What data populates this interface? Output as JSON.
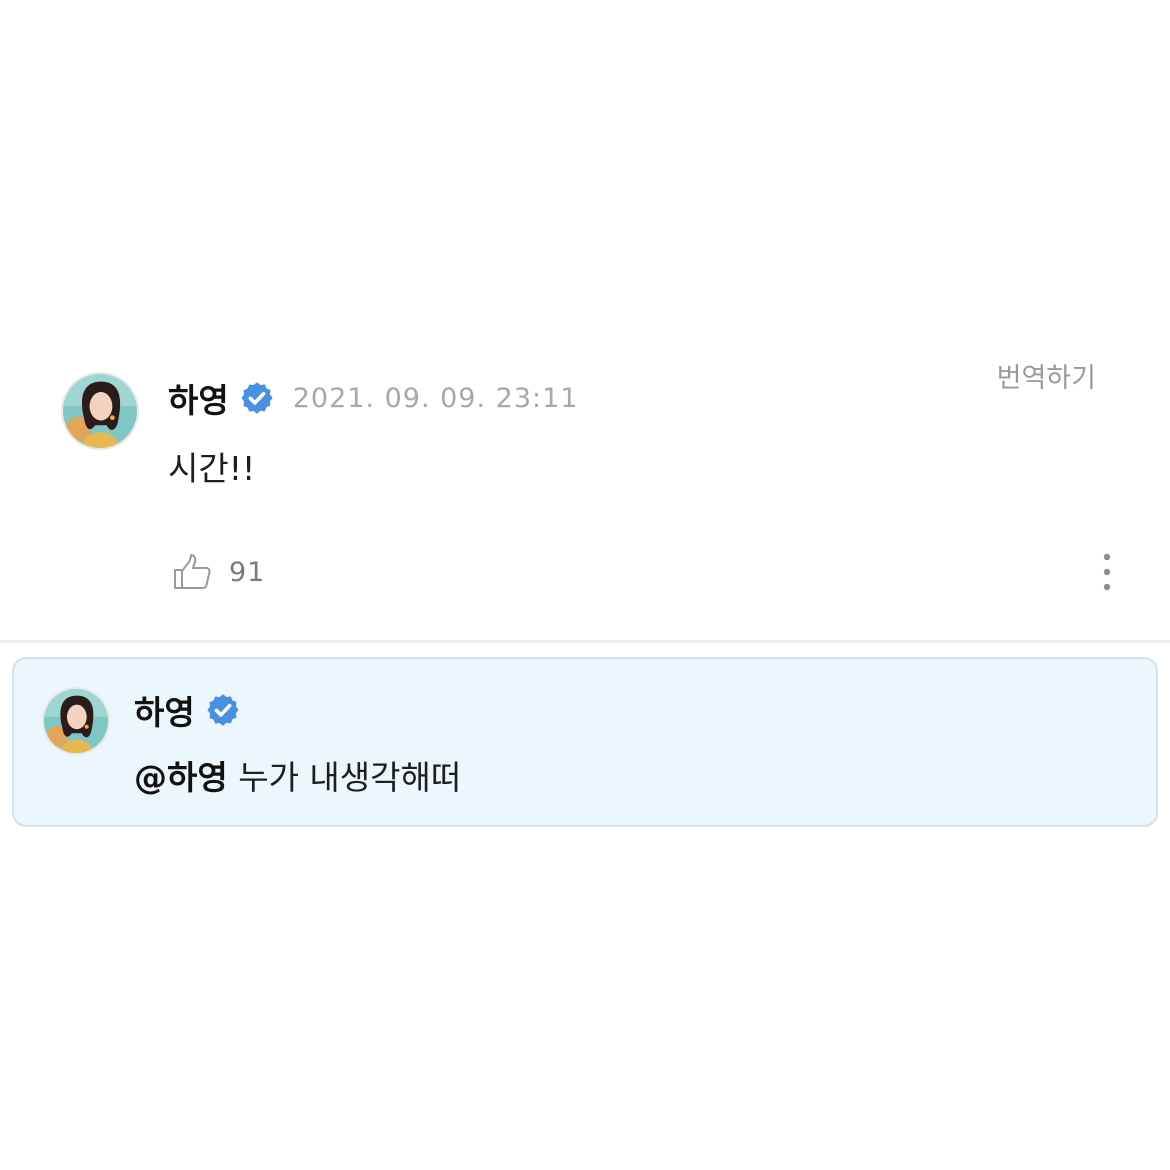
{
  "post": {
    "author": "하영",
    "verified_icon": "verified-badge-icon",
    "timestamp": "2021. 09. 09. 23:11",
    "translate_label": "번역하기",
    "body": "시간!!",
    "like_icon": "thumbs-up-icon",
    "like_count": "91",
    "more_icon": "more-vertical-icon"
  },
  "reply": {
    "author": "하영",
    "verified_icon": "verified-badge-icon",
    "mention": "@하영",
    "text": " 누가 내생각해떠"
  },
  "colors": {
    "verified_blue": "#4a90e2",
    "reply_background": "#ecf7fd",
    "reply_border": "#cfe4ee",
    "muted_text": "#a8a8a8"
  }
}
